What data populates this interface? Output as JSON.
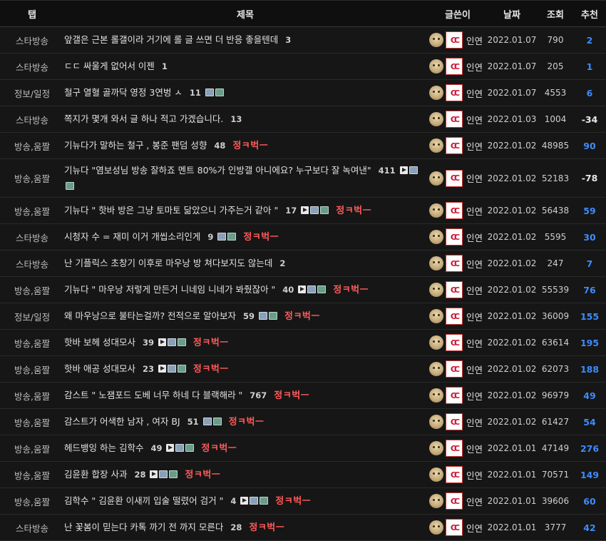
{
  "header": {
    "tab": "탭",
    "title": "제목",
    "author": "글쓴이",
    "date": "날짜",
    "views": "조회",
    "rec": "추천"
  },
  "author_name": "인연",
  "badge_text": "CC",
  "jeong_text": "정ㅋ벅ㅡ",
  "colors": {
    "background": "#161616",
    "recommend_positive": "#3d8cff",
    "recommend_negative": "#e8e8e8",
    "jeong": "#ff5a5a"
  },
  "posts": [
    {
      "tab": "스타방송",
      "title": "앞갤은 근본 롤갤이라 거기에 롤 글 쓰면 더 반응 좋을텐데",
      "count": "3",
      "media": [],
      "jeong": false,
      "date": "2022.01.07",
      "views": "790",
      "rec": "2"
    },
    {
      "tab": "스타방송",
      "title": "ㄷㄷ 싸울게 없어서 이젠",
      "count": "1",
      "media": [],
      "jeong": false,
      "date": "2022.01.07",
      "views": "205",
      "rec": "1"
    },
    {
      "tab": "정보/일정",
      "title": "철구 열혈 골까닥 영정 3연벙 ㅅ",
      "count": "11",
      "media": [
        "image",
        "file"
      ],
      "jeong": false,
      "date": "2022.01.07",
      "views": "4553",
      "rec": "6"
    },
    {
      "tab": "스타방송",
      "title": "쪽지가 몇개 와서 글 하나 적고 가겠습니다.",
      "count": "13",
      "media": [],
      "jeong": false,
      "date": "2022.01.03",
      "views": "1004",
      "rec": "-34"
    },
    {
      "tab": "방송,움짤",
      "title": "기뉴다가 말하는 철구 , 봉준 팬덤 성향",
      "count": "48",
      "media": [],
      "jeong": true,
      "date": "2022.01.02",
      "views": "48985",
      "rec": "90"
    },
    {
      "tab": "방송,움짤",
      "title": "기뉴다 \"염보성님 방송 잘하죠 멘트 80%가 인방갤 아니에요? 누구보다 잘 녹여낸\"",
      "count": "411",
      "media": [
        "video",
        "image",
        "file"
      ],
      "jeong": false,
      "date": "2022.01.02",
      "views": "52183",
      "rec": "-78",
      "tall": true
    },
    {
      "tab": "방송,움짤",
      "title": "기뉴다 \" 핫바 방은 그냥 토마토 닮았으니 가주는거 같아 \"",
      "count": "17",
      "media": [
        "video",
        "image",
        "file"
      ],
      "jeong": true,
      "date": "2022.01.02",
      "views": "56438",
      "rec": "59"
    },
    {
      "tab": "스타방송",
      "title": "시청자 수 = 재미 이거 개씹소리인게",
      "count": "9",
      "media": [
        "image",
        "file"
      ],
      "jeong": true,
      "date": "2022.01.02",
      "views": "5595",
      "rec": "30"
    },
    {
      "tab": "스타방송",
      "title": "난 기플릭스 초창기 이후로 마우낭 방 쳐다보지도 않는데",
      "count": "2",
      "media": [],
      "jeong": false,
      "date": "2022.01.02",
      "views": "247",
      "rec": "7"
    },
    {
      "tab": "방송,움짤",
      "title": "기뉴다 \" 마우낭 저렇게 만든거 니네임 니네가 봐줬잖아 \"",
      "count": "40",
      "media": [
        "video",
        "image",
        "file"
      ],
      "jeong": true,
      "date": "2022.01.02",
      "views": "55539",
      "rec": "76"
    },
    {
      "tab": "정보/일정",
      "title": "왜 마우낭으로 불타는걸까? 전적으로 알아보자",
      "count": "59",
      "media": [
        "image",
        "file"
      ],
      "jeong": true,
      "date": "2022.01.02",
      "views": "36009",
      "rec": "155"
    },
    {
      "tab": "방송,움짤",
      "title": "핫바 보헤 성대모사",
      "count": "39",
      "media": [
        "video",
        "image",
        "file"
      ],
      "jeong": true,
      "date": "2022.01.02",
      "views": "63614",
      "rec": "195"
    },
    {
      "tab": "방송,움짤",
      "title": "핫바 애공 성대모사",
      "count": "23",
      "media": [
        "video",
        "image",
        "file"
      ],
      "jeong": true,
      "date": "2022.01.02",
      "views": "62073",
      "rec": "188"
    },
    {
      "tab": "방송,움짤",
      "title": "감스트 \" 노잼포드 도베 너무 하네 다 블랙해라 \"",
      "count": "767",
      "media": [],
      "jeong": true,
      "date": "2022.01.02",
      "views": "96979",
      "rec": "49"
    },
    {
      "tab": "방송,움짤",
      "title": "감스트가 어색한 남자 , 여자 BJ",
      "count": "51",
      "media": [
        "image",
        "file"
      ],
      "jeong": true,
      "date": "2022.01.02",
      "views": "61427",
      "rec": "54"
    },
    {
      "tab": "방송,움짤",
      "title": "헤드뱅잉 하는 김학수",
      "count": "49",
      "media": [
        "video",
        "image",
        "file"
      ],
      "jeong": true,
      "date": "2022.01.01",
      "views": "47149",
      "rec": "276"
    },
    {
      "tab": "방송,움짤",
      "title": "김윤환 합장 사과",
      "count": "28",
      "media": [
        "video",
        "image",
        "file"
      ],
      "jeong": true,
      "date": "2022.01.01",
      "views": "70571",
      "rec": "149"
    },
    {
      "tab": "방송,움짤",
      "title": "김학수 \" 김윤환 이새끼 입술 떨렸어 검거 \"",
      "count": "4",
      "media": [
        "video",
        "image",
        "file"
      ],
      "jeong": true,
      "date": "2022.01.01",
      "views": "39606",
      "rec": "60"
    },
    {
      "tab": "스타방송",
      "title": "난 꽃봄이 믿는다 카톡 까기 전 까지 모른다",
      "count": "28",
      "media": [],
      "jeong": true,
      "date": "2022.01.01",
      "views": "3777",
      "rec": "42"
    }
  ]
}
